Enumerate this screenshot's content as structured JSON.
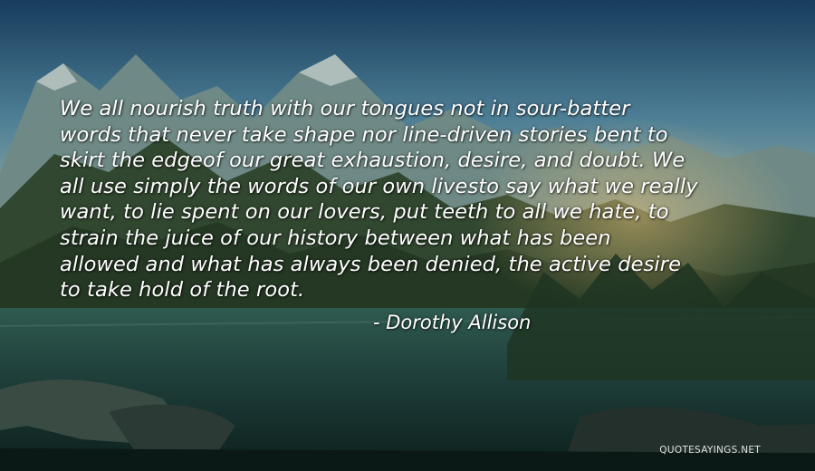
{
  "quote": {
    "lines": [
      "We all nourish truth with our tongues not in sour-batter",
      "words that never take shape nor line-driven stories bent to",
      "skirt the edgeof our great exhaustion, desire, and doubt. We",
      "all use simply the words of our own livesto say what we really",
      "want, to lie spent on our lovers, put teeth to all we hate, to",
      "strain the juice of our history between what has been",
      "allowed and what has always been denied, the active desire",
      "to take hold of the root."
    ],
    "author": "- Dorothy Allison"
  },
  "watermark": "QUOTESAYINGS.NET",
  "colors": {
    "text": "#ffffff",
    "sky": "#3d6f8c",
    "lake": "#1c3a36"
  }
}
